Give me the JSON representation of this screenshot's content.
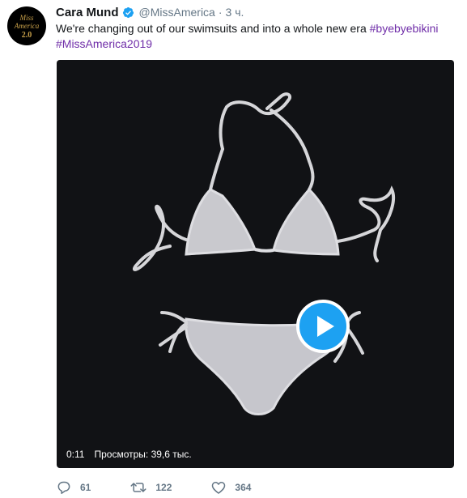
{
  "tweet": {
    "display_name": "Cara Mund",
    "handle": "@MissAmerica",
    "separator": "·",
    "time": "3 ч.",
    "text_before": "We're changing out of our swimsuits and into a whole new era ",
    "hashtags": [
      "#byebyebikini",
      "#MissAmerica2019"
    ],
    "avatar_logo": [
      "Miss",
      "America",
      "2.0"
    ]
  },
  "media": {
    "duration": "0:11",
    "views": "Просмотры: 39,6 тыс.",
    "play_icon": "play-icon"
  },
  "actions": {
    "reply_count": "61",
    "retweet_count": "122",
    "like_count": "364"
  },
  "colors": {
    "accent": "#1da1f2",
    "hashtag": "#6f2da8",
    "muted": "#657786",
    "media_bg": "#111215",
    "logo_gold": "#c9a14a"
  }
}
